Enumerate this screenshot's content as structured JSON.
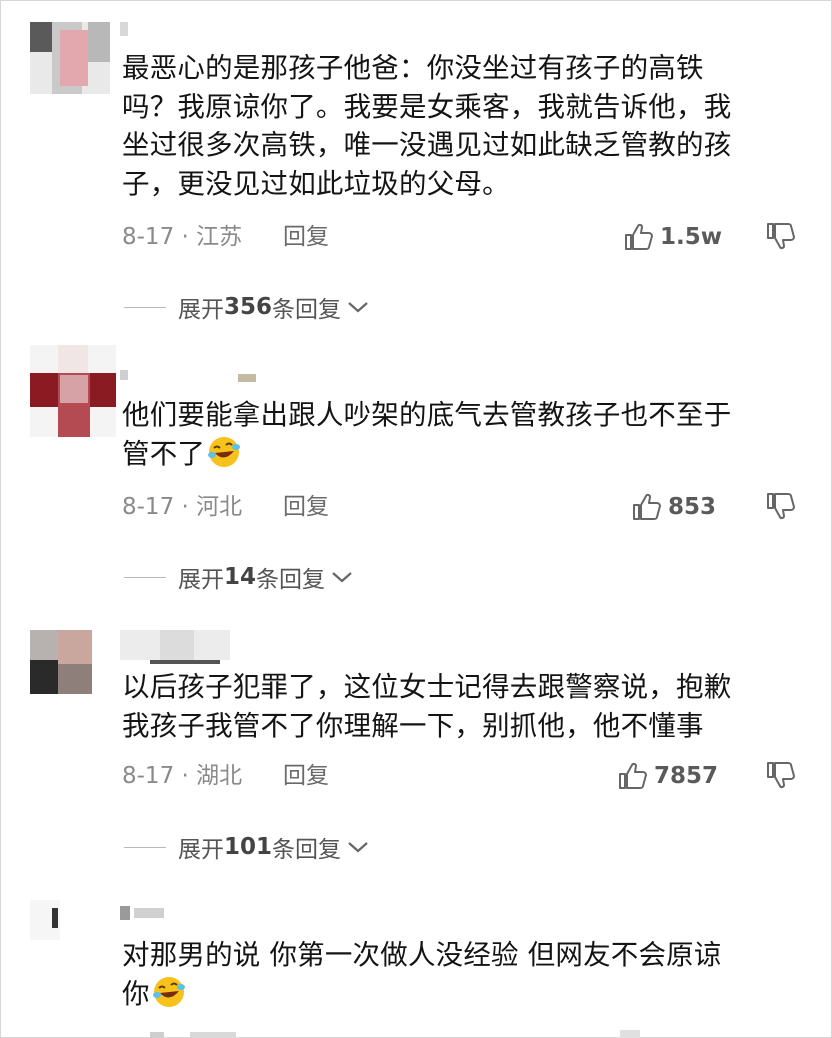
{
  "comments": [
    {
      "text": "最恶心的是那孩子他爸：你没坐过有孩子的高铁\n吗？我原谅你了。我要是女乘客，我就告诉他，我\n坐过很多次高铁，唯一没遇见过如此缺乏管教的孩\n子，更没见过如此垃圾的父母。",
      "date_location": "8-17 · 江苏",
      "reply_label": "回复",
      "likes": "1.5w",
      "expand": {
        "prefix": "展开",
        "count": "356",
        "suffix": "条回复"
      }
    },
    {
      "text": "他们要能拿出跟人吵架的底气去管教孩子也不至于\n管不了",
      "date_location": "8-17 · 河北",
      "reply_label": "回复",
      "likes": "853",
      "expand": {
        "prefix": "展开",
        "count": "14",
        "suffix": "条回复"
      }
    },
    {
      "text": "以后孩子犯罪了，这位女士记得去跟警察说，抱歉\n我孩子我管不了你理解一下，别抓他，他不懂事",
      "date_location": "8-17 · 湖北",
      "reply_label": "回复",
      "likes": "7857",
      "expand": {
        "prefix": "展开",
        "count": "101",
        "suffix": "条回复"
      }
    },
    {
      "text": "对那男的说 你第一次做人没经验 但网友不会原谅\n你"
    }
  ],
  "icons": {
    "like": "thumbs-up-icon",
    "dislike": "thumbs-down-icon",
    "expand": "chevron-down-icon",
    "emoji": "rolling-laughing-emoji-icon"
  },
  "colors": {
    "text": "#141414",
    "meta": "#8a8a8a",
    "emoji_face": "#f7c21b"
  }
}
